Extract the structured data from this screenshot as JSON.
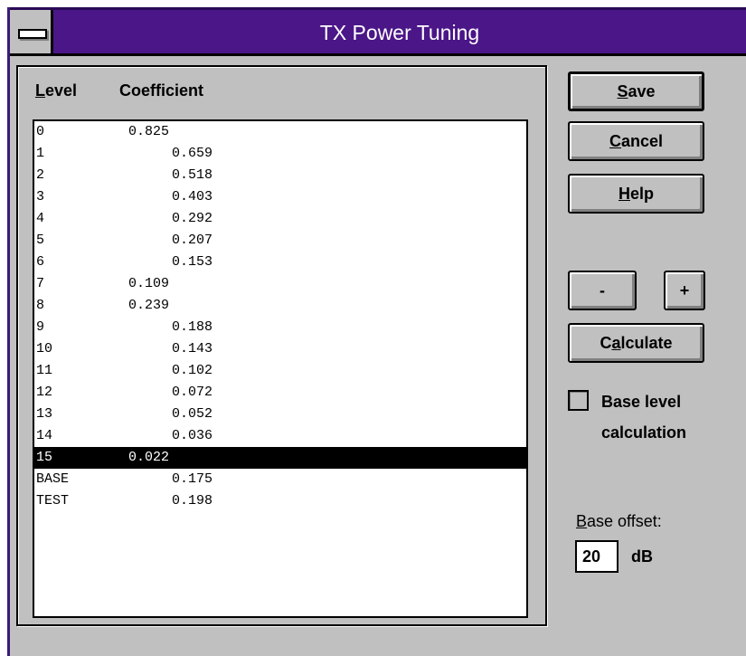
{
  "window": {
    "title": "TX Power Tuning"
  },
  "list": {
    "header_level": "Level",
    "header_coefficient": "Coefficient",
    "rows": [
      {
        "level": "0",
        "coef": "0.825",
        "indent": false
      },
      {
        "level": "1",
        "coef": "0.659",
        "indent": true
      },
      {
        "level": "2",
        "coef": "0.518",
        "indent": true
      },
      {
        "level": "3",
        "coef": "0.403",
        "indent": true
      },
      {
        "level": "4",
        "coef": "0.292",
        "indent": true
      },
      {
        "level": "5",
        "coef": "0.207",
        "indent": true
      },
      {
        "level": "6",
        "coef": "0.153",
        "indent": true
      },
      {
        "level": "7",
        "coef": "0.109",
        "indent": false
      },
      {
        "level": "8",
        "coef": "0.239",
        "indent": false
      },
      {
        "level": "9",
        "coef": "0.188",
        "indent": true
      },
      {
        "level": "10",
        "coef": "0.143",
        "indent": true
      },
      {
        "level": "11",
        "coef": "0.102",
        "indent": true
      },
      {
        "level": "12",
        "coef": "0.072",
        "indent": true
      },
      {
        "level": "13",
        "coef": "0.052",
        "indent": true
      },
      {
        "level": "14",
        "coef": "0.036",
        "indent": true
      },
      {
        "level": "15",
        "coef": "0.022",
        "indent": false
      },
      {
        "level": "BASE",
        "coef": "0.175",
        "indent": true
      },
      {
        "level": "TEST",
        "coef": "0.198",
        "indent": true
      }
    ],
    "selected_level": "15"
  },
  "buttons": {
    "save": "Save",
    "cancel": "Cancel",
    "help": "Help",
    "minus": "-",
    "plus": "+",
    "calculate": "Calculate"
  },
  "checkbox": {
    "label_line1": "Base level",
    "label_line2": "calculation",
    "checked": false
  },
  "offset": {
    "label": "Base offset:",
    "value": "20",
    "unit": "dB"
  },
  "colors": {
    "titlebar": "#4b1688",
    "face": "#c0c0c0",
    "selection": "#000000"
  },
  "icons": {
    "system_menu": "system-menu-icon"
  }
}
